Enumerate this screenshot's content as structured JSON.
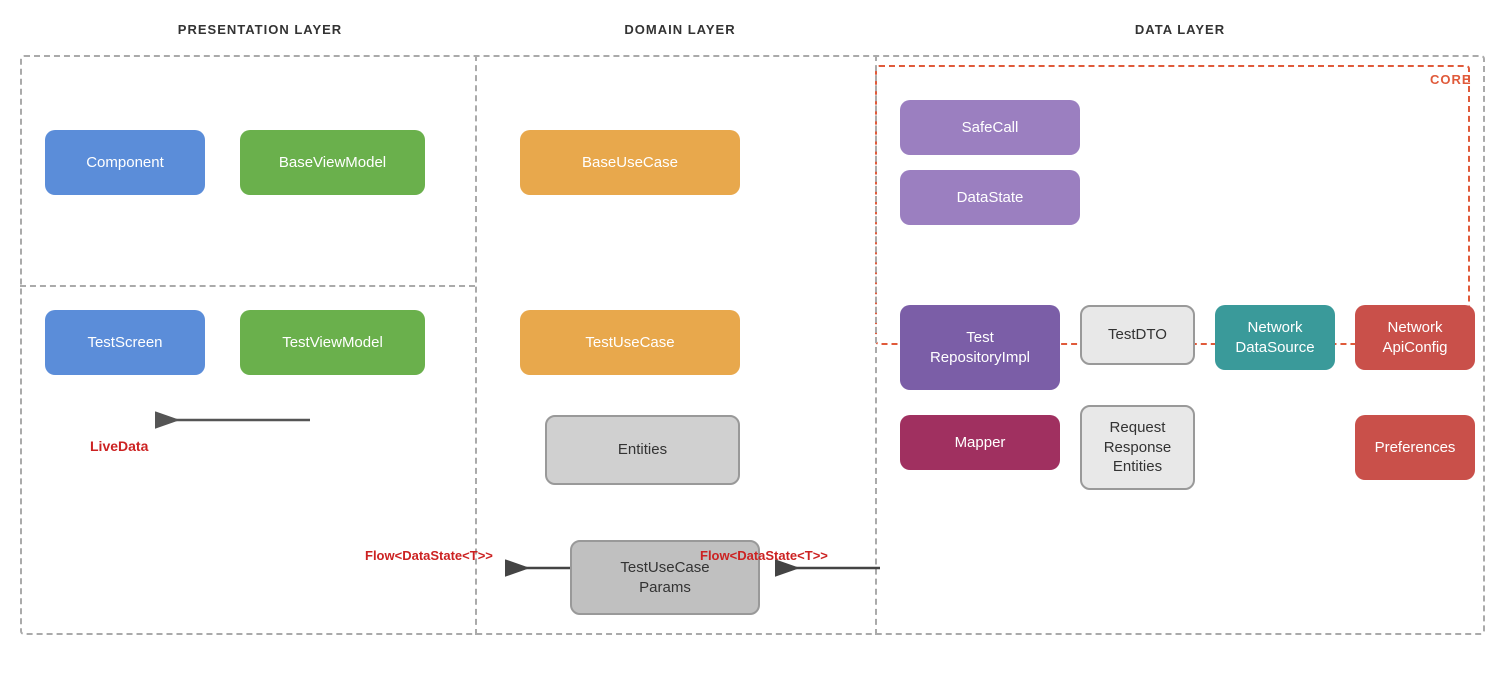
{
  "layers": {
    "presentation": {
      "label": "PRESENTATION LAYER"
    },
    "domain": {
      "label": "DOMAIN LAYER"
    },
    "data": {
      "label": "DATA LAYER"
    }
  },
  "nodes": {
    "component": {
      "label": "Component"
    },
    "baseviewmodel": {
      "label": "BaseViewModel"
    },
    "testscreen": {
      "label": "TestScreen"
    },
    "testviewmodel": {
      "label": "TestViewModel"
    },
    "baseusecase": {
      "label": "BaseUseCase"
    },
    "testusecase": {
      "label": "TestUseCase"
    },
    "entities": {
      "label": "Entities"
    },
    "safecall": {
      "label": "SafeCall"
    },
    "datastate": {
      "label": "DataState"
    },
    "testrepositoryimpl": {
      "label": "Test\nRepositoryImpl"
    },
    "testdto": {
      "label": "TestDTO"
    },
    "networkdatasource": {
      "label": "Network\nDataSource"
    },
    "networkapiconfig": {
      "label": "Network\nApiConfig"
    },
    "mapper": {
      "label": "Mapper"
    },
    "requestresponseentities": {
      "label": "Request\nResponse\nEntities"
    },
    "preferences": {
      "label": "Preferences"
    },
    "testusecaseparams": {
      "label": "TestUseCase\nParams"
    }
  },
  "labels": {
    "core": "CORE",
    "livedata": "LiveData",
    "flow_left": "Flow<DataState<T>>",
    "flow_right": "Flow<DataState<T>>"
  }
}
